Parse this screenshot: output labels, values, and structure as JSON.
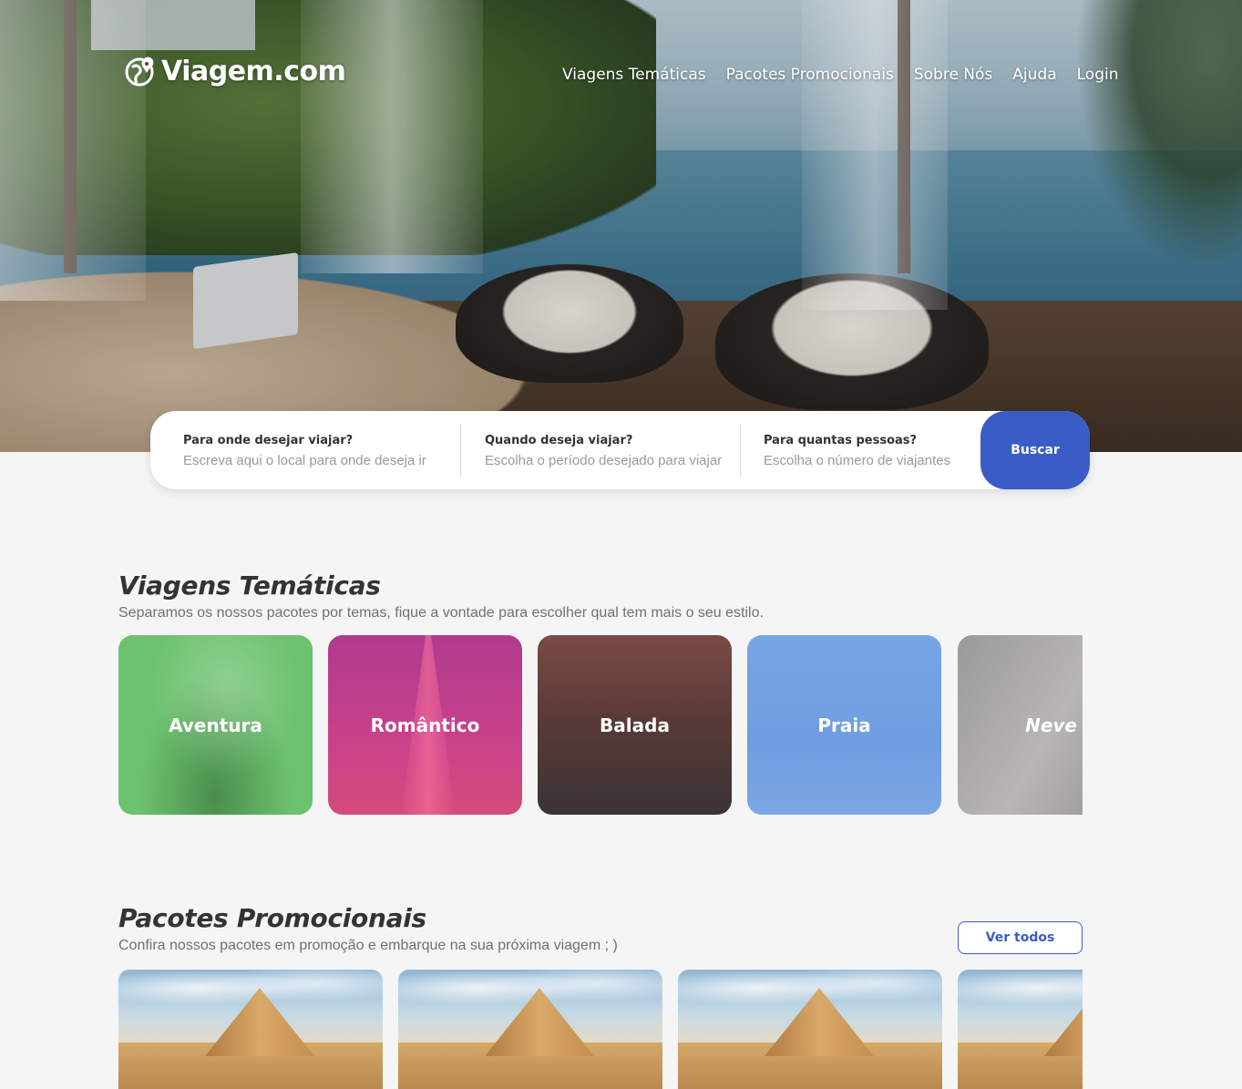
{
  "brand": {
    "name": "Viagem.com"
  },
  "nav": {
    "items": [
      "Viagens Temáticas",
      "Pacotes Promocionais",
      "Sobre Nós",
      "Ajuda",
      "Login"
    ]
  },
  "search": {
    "destination": {
      "label": "Para onde desejar viajar?",
      "placeholder": "Escreva aqui o local para onde deseja ir"
    },
    "when": {
      "label": "Quando deseja viajar?",
      "placeholder": "Escolha o período desejado para viajar"
    },
    "people": {
      "label": "Para quantas pessoas?",
      "placeholder": "Escolha o número de viajantes"
    },
    "button": "Buscar"
  },
  "themes": {
    "title": "Viagens Temáticas",
    "subtitle": "Separamos os nossos pacotes por temas, fique a vontade para escolher qual tem mais o seu estilo.",
    "items": [
      "Aventura",
      "Romântico",
      "Balada",
      "Praia",
      "Neve"
    ]
  },
  "promos": {
    "title": "Pacotes Promocionais",
    "subtitle": "Confira nossos pacotes em promoção e embarque na sua próxima viagem  ; )",
    "view_all": "Ver todos"
  },
  "colors": {
    "accent": "#3a5cc7",
    "aventura": "#6ac36f",
    "romantico": "#c9428a",
    "balada": "#3a3435",
    "praia": "#6e9de1",
    "neve": "#9a9a9a"
  }
}
